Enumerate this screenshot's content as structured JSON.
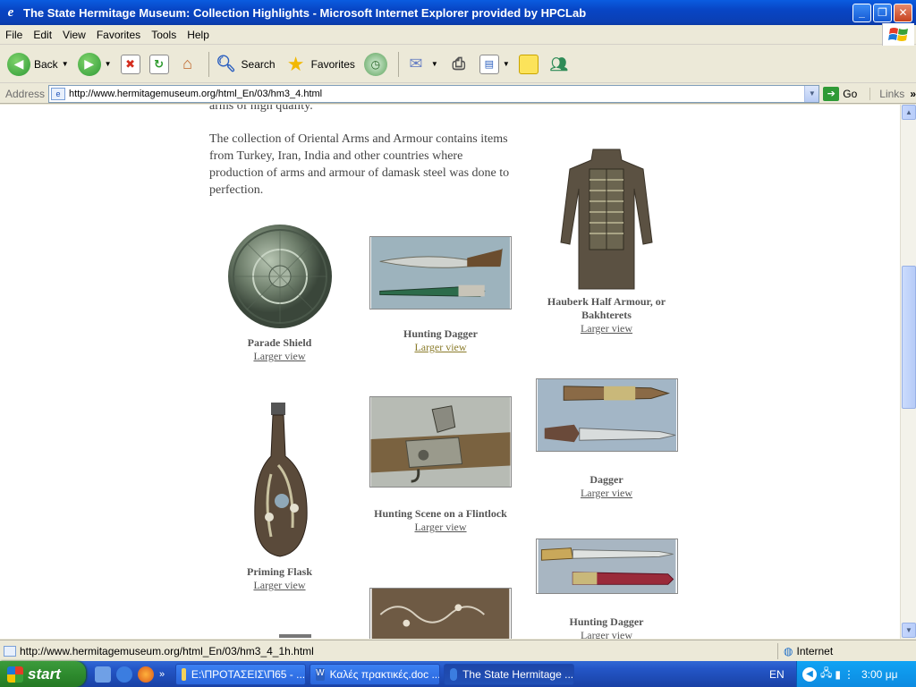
{
  "window": {
    "title": "The State Hermitage Museum: Collection Highlights - Microsoft Internet Explorer provided by HPCLab"
  },
  "menu": [
    "File",
    "Edit",
    "View",
    "Favorites",
    "Tools",
    "Help"
  ],
  "toolbar": {
    "back": "Back",
    "search": "Search",
    "favorites": "Favorites"
  },
  "address": {
    "label": "Address",
    "url": "http://www.hermitagemuseum.org/html_En/03/hm3_4.html",
    "go": "Go",
    "links": "Links"
  },
  "page": {
    "text_top": "arms of high quality.",
    "text_para": "The collection of Oriental Arms and Armour contains items from Turkey, Iran, India and other countries where production of arms and armour of damask steel was done to perfection.",
    "items": [
      {
        "caption": "Parade Shield",
        "link": "Larger view"
      },
      {
        "caption": "Hunting Dagger",
        "link": "Larger view"
      },
      {
        "caption": "Hauberk Half Armour, or Bakhterets",
        "link": "Larger view"
      },
      {
        "caption": "Priming Flask",
        "link": "Larger view"
      },
      {
        "caption": "Hunting Scene on a Flintlock",
        "link": "Larger view"
      },
      {
        "caption": "Dagger",
        "link": "Larger view"
      },
      {
        "caption": "Hunting Dagger",
        "link": "Larger view"
      }
    ]
  },
  "status": {
    "url": "http://www.hermitagemuseum.org/html_En/03/hm3_4_1h.html",
    "zone": "Internet"
  },
  "taskbar": {
    "start": "start",
    "tasks": [
      "E:\\ΠΡΟΤΑΣΕΙΣ\\Π65 - ...",
      "Καλές πρακτικές.doc ...",
      "The State Hermitage ..."
    ],
    "lang": "EN",
    "clock": "3:00 μμ"
  }
}
